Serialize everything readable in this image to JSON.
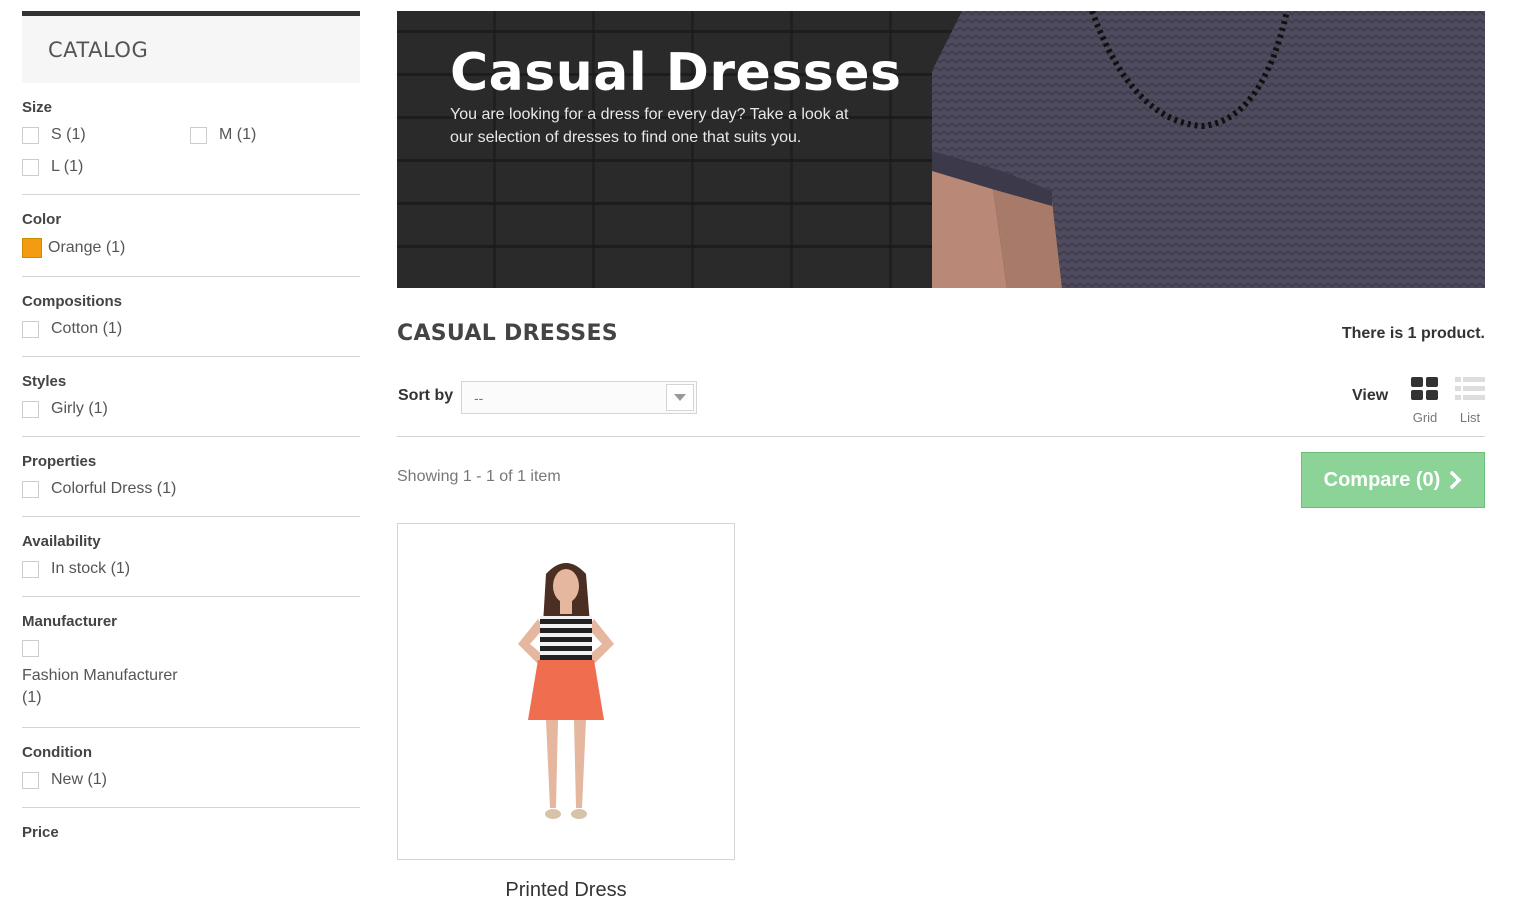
{
  "sidebar": {
    "title": "CATALOG",
    "filters": [
      {
        "title": "Size",
        "options": [
          "S (1)",
          "M (1)",
          "L (1)"
        ]
      },
      {
        "title": "Color",
        "options": [
          "Orange (1)"
        ],
        "swatch": "#f39c11"
      },
      {
        "title": "Compositions",
        "options": [
          "Cotton (1)"
        ]
      },
      {
        "title": "Styles",
        "options": [
          "Girly (1)"
        ]
      },
      {
        "title": "Properties",
        "options": [
          "Colorful Dress (1)"
        ]
      },
      {
        "title": "Availability",
        "options": [
          "In stock (1)"
        ]
      },
      {
        "title": "Manufacturer",
        "options": [
          "Fashion Manufacturer (1)"
        ]
      },
      {
        "title": "Condition",
        "options": [
          "New (1)"
        ]
      },
      {
        "title": "Price",
        "options": []
      }
    ]
  },
  "banner": {
    "title": "Casual Dresses",
    "description": "You are looking for a dress for every day? Take a look at our selection of dresses to find one that suits you."
  },
  "category": {
    "title": "CASUAL DRESSES",
    "product_count": "There is 1 product."
  },
  "toolbar": {
    "sort_label": "Sort by",
    "sort_value": "--",
    "view_label": "View",
    "grid_label": "Grid",
    "list_label": "List",
    "showing": "Showing 1 - 1 of 1 item",
    "compare_label": "Compare (0)"
  },
  "products": [
    {
      "name": "Printed Dress"
    }
  ],
  "colors": {
    "compare_green": "#8cd397",
    "orange_swatch": "#f39c11",
    "accent_dark": "#333333"
  }
}
